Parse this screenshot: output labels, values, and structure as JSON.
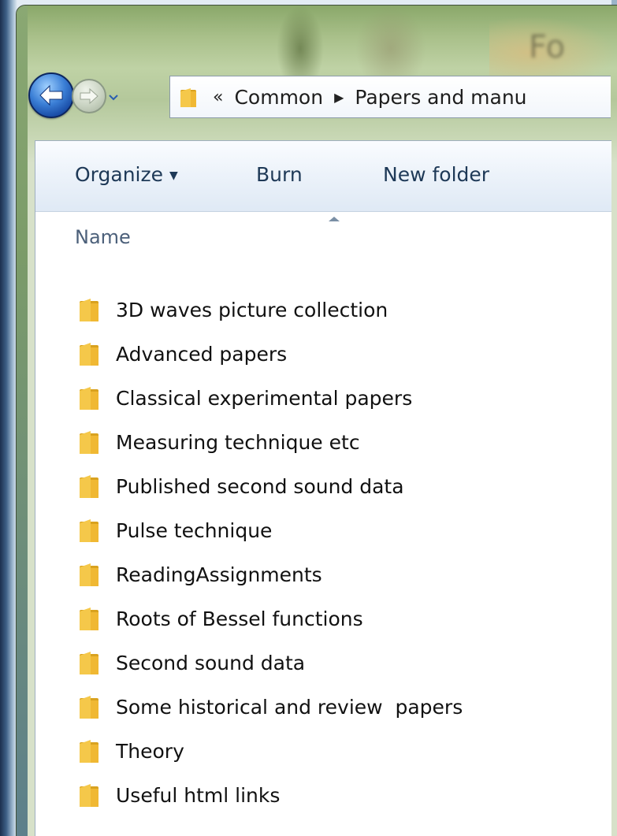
{
  "window": {
    "title_fragment": "Fo"
  },
  "navigation": {
    "back_icon": "back-arrow-icon",
    "forward_icon": "forward-arrow-icon",
    "history_icon": "chevron-down-icon"
  },
  "address_bar": {
    "overflow_chevron": "«",
    "crumbs": [
      "Common",
      "Papers and manu"
    ]
  },
  "toolbar": {
    "organize_label": "Organize",
    "burn_label": "Burn",
    "new_folder_label": "New folder"
  },
  "columns": {
    "name_label": "Name"
  },
  "files": [
    "3D waves picture collection",
    "Advanced papers",
    "Classical experimental papers",
    "Measuring technique etc",
    "Published second sound data",
    "Pulse technique",
    "ReadingAssignments",
    "Roots of Bessel functions",
    "Second sound data",
    "Some historical and review  papers",
    "Theory",
    "Useful html links"
  ],
  "colors": {
    "folder_front": "#f5c84a",
    "folder_back": "#d9a21f",
    "toolbar_text": "#1e3957",
    "accent_blue": "#3b7fd6"
  }
}
